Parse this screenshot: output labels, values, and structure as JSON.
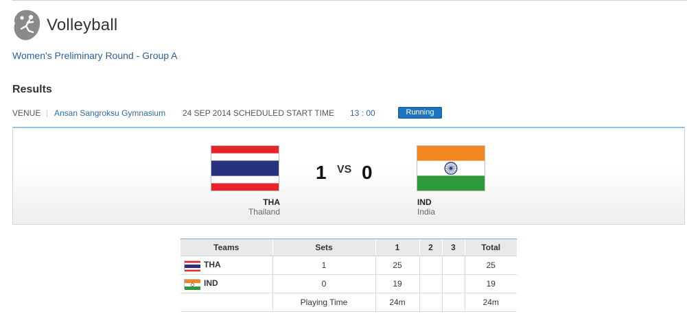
{
  "header": {
    "sport": "Volleyball",
    "sport_icon": "volleyball-player-icon",
    "round": "Women's Preliminary Round - Group A"
  },
  "results": {
    "title": "Results",
    "venue_label": "VENUE",
    "venue_name": "Ansan Sangroksu Gymnasium",
    "date_label": "24 SEP 2014 SCHEDULED START TIME",
    "start_time": "13 : 00",
    "status": "Running"
  },
  "match": {
    "home": {
      "code": "THA",
      "name": "Thailand",
      "flag": "thailand-flag",
      "score": "1"
    },
    "away": {
      "code": "IND",
      "name": "India",
      "flag": "india-flag",
      "score": "0"
    },
    "vs": "VS"
  },
  "table": {
    "headers": [
      "Teams",
      "Sets",
      "1",
      "2",
      "3",
      "Total"
    ],
    "rows": [
      {
        "team": "THA",
        "sets": "1",
        "s1": "25",
        "s2": "",
        "s3": "",
        "total": "25"
      },
      {
        "team": "IND",
        "sets": "0",
        "s1": "19",
        "s2": "",
        "s3": "",
        "total": "19"
      }
    ],
    "playing_time_label": "Playing Time",
    "playing_time_s1": "24m",
    "playing_time_total": "24m"
  },
  "colors": {
    "link": "#2c5f99",
    "badge": "#1e73be",
    "panel_top": "#8fc3e8"
  }
}
